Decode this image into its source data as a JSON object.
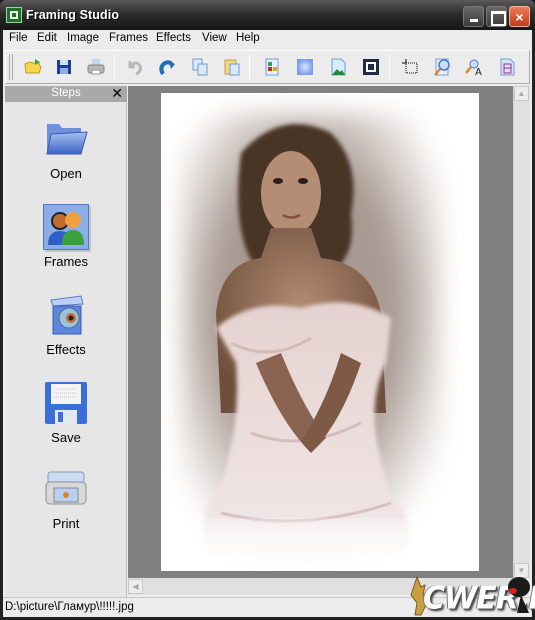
{
  "window": {
    "title": "Framing Studio",
    "controls": {
      "minimize": "minimize",
      "maximize": "maximize",
      "close": "×"
    }
  },
  "menubar": {
    "items": [
      "File",
      "Edit",
      "Image",
      "Frames",
      "Effects",
      "View",
      "Help"
    ]
  },
  "toolbar": {
    "buttons": [
      {
        "name": "open-file-icon",
        "tooltip": "Open"
      },
      {
        "name": "save-icon",
        "tooltip": "Save"
      },
      {
        "name": "print-icon",
        "tooltip": "Print"
      },
      {
        "name": "undo-icon",
        "tooltip": "Undo"
      },
      {
        "name": "redo-icon",
        "tooltip": "Redo"
      },
      {
        "name": "copy-icon",
        "tooltip": "Copy"
      },
      {
        "name": "paste-icon",
        "tooltip": "Paste"
      },
      {
        "name": "color-adjust-icon",
        "tooltip": "Colors"
      },
      {
        "name": "blur-icon",
        "tooltip": "Blur"
      },
      {
        "name": "image-icon",
        "tooltip": "Image"
      },
      {
        "name": "frame-icon",
        "tooltip": "Frame"
      },
      {
        "name": "crop-icon",
        "tooltip": "Crop"
      },
      {
        "name": "zoom-icon",
        "tooltip": "Zoom"
      },
      {
        "name": "text-tool-icon",
        "tooltip": "Text"
      },
      {
        "name": "filmstrip-icon",
        "tooltip": "Film"
      }
    ]
  },
  "sidebar": {
    "title": "Steps",
    "close_label": "✕",
    "steps": [
      {
        "label": "Open",
        "icon": "folder-icon",
        "active": false
      },
      {
        "label": "Frames",
        "icon": "users-icon",
        "active": true
      },
      {
        "label": "Effects",
        "icon": "effects-box-icon",
        "active": false
      },
      {
        "label": "Save",
        "icon": "floppy-disk-icon",
        "active": false
      },
      {
        "label": "Print",
        "icon": "printer-icon",
        "active": false
      }
    ]
  },
  "scrollbars": {
    "up": "▲",
    "down": "▼",
    "left": "◀"
  },
  "status": {
    "path": "D:\\picture\\Гламур\\!!!!!.jpg"
  },
  "watermark": {
    "text": "CWER.RU"
  },
  "colors": {
    "workspace_bg": "#808080",
    "panel_bg": "#e6e6e6",
    "steps_header": "#a9a9a9",
    "active_step": "#8aaee8"
  }
}
